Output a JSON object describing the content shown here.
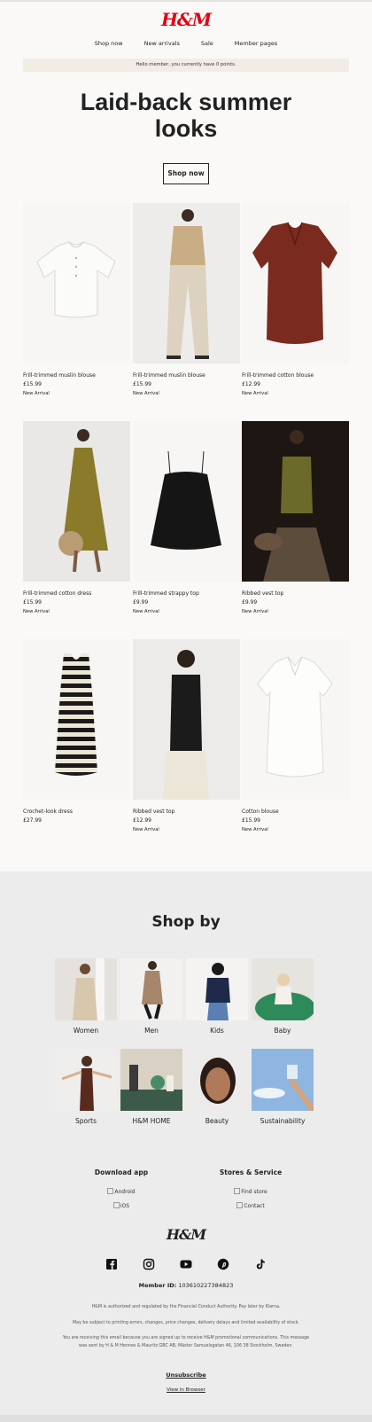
{
  "header": {
    "logo": "H&M",
    "nav": [
      "Shop now",
      "New arrivals",
      "Sale",
      "Member pages"
    ],
    "banner": "Hello member, you currently have 0 points."
  },
  "hero": {
    "line1": "Laid-back summer",
    "line2": "looks",
    "cta": "Shop now"
  },
  "products": [
    {
      "name": "Frill-trimmed muslin blouse",
      "price": "£15.99",
      "tag": "New Arrival"
    },
    {
      "name": "Frill-trimmed muslin blouse",
      "price": "£15.99",
      "tag": "New Arrival"
    },
    {
      "name": "Frill-trimmed cotton blouse",
      "price": "£12.99",
      "tag": "New Arrival"
    },
    {
      "name": "Frill-trimmed cotton dress",
      "price": "£15.99",
      "tag": "New Arrival"
    },
    {
      "name": "Frill-trimmed strappy top",
      "price": "£9.99",
      "tag": "New Arrival"
    },
    {
      "name": "Ribbed vest top",
      "price": "£9.99",
      "tag": "New Arrival"
    },
    {
      "name": "Crochet-look dress",
      "price": "£27.99",
      "tag": ""
    },
    {
      "name": "Ribbed vest top",
      "price": "£12.99",
      "tag": "New Arrival"
    },
    {
      "name": "Cotton blouse",
      "price": "£15.99",
      "tag": "New Arrival"
    }
  ],
  "shop_by": {
    "title": "Shop by",
    "categories": [
      "Women",
      "Men",
      "Kids",
      "Baby",
      "Sports",
      "H&M HOME",
      "Beauty",
      "Sustainability"
    ]
  },
  "footer": {
    "download_title": "Download app",
    "download_links": [
      "Android",
      "iOS"
    ],
    "stores_title": "Stores & Service",
    "stores_links": [
      "Find store",
      "Contact"
    ],
    "logo": "H&M",
    "socials": [
      "facebook-icon",
      "instagram-icon",
      "youtube-icon",
      "pinterest-icon",
      "tiktok-icon"
    ],
    "member_label": "Member ID:",
    "member_id": "103610227384823",
    "legal1": "H&M is authorized and regulated by the Financial Conduct Authority. Pay later by Klarna.",
    "legal2": "May be subject to printing errors, changes, price changes, delivery delays and limited availability of stock.",
    "legal3": "You are receiving this email because you are signed up to receive H&M promotional communications. This message was sent by H & M Hennes & Mauritz GBC AB, Mäster Samuelsgatan 46, 106 38 Stockholm, Sweden.",
    "unsubscribe": "Unsubscribe",
    "view_browser": "View in Browser"
  },
  "colors": {
    "brand_red": "#e50010",
    "banner": "#f2ede4",
    "page_bg": "#faf9f8",
    "footer_bg": "#ececec"
  }
}
